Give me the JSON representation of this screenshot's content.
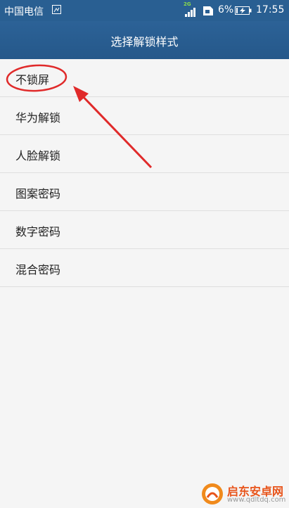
{
  "status_bar": {
    "carrier": "中国电信",
    "network_type": "2G",
    "battery": "6%",
    "time": "17:55"
  },
  "header": {
    "title": "选择解锁样式"
  },
  "options": [
    {
      "label": "不锁屏",
      "highlighted": true
    },
    {
      "label": "华为解锁"
    },
    {
      "label": "人脸解锁"
    },
    {
      "label": "图案密码"
    },
    {
      "label": "数字密码"
    },
    {
      "label": "混合密码"
    }
  ],
  "annotation": {
    "color": "#e02a2a"
  },
  "watermark": {
    "name": "启东安卓网",
    "url": "www.qdltdq.com"
  },
  "colors": {
    "status_bar": "#295f92",
    "title_bar": "#2a5d91",
    "background": "#f5f5f5"
  }
}
